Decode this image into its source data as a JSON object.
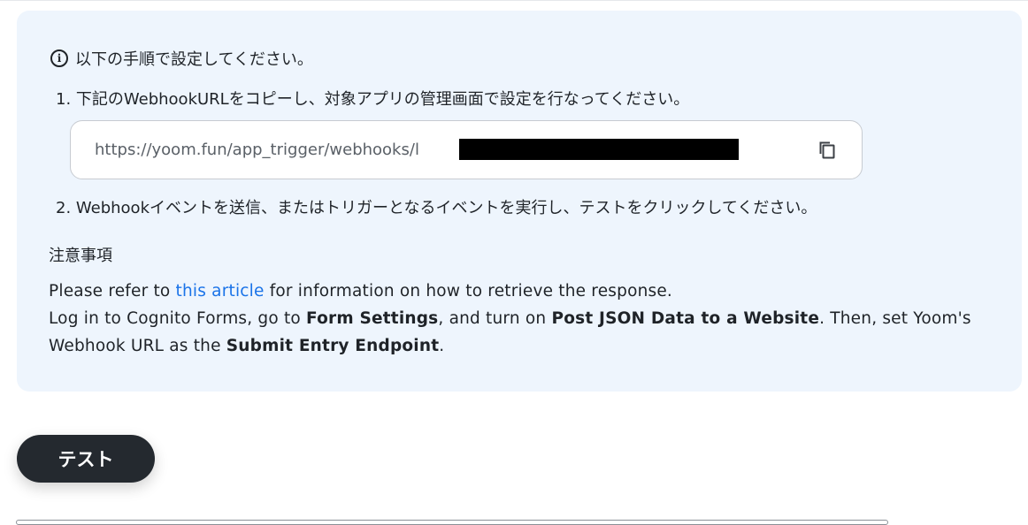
{
  "info": {
    "icon": "info-icon",
    "glyph": "i",
    "text": "以下の手順で設定してください。"
  },
  "steps": [
    {
      "text": "1. 下記のWebhookURLをコピーし、対象アプリの管理画面で設定を行なってください。"
    },
    {
      "text": "2. Webhookイベントを送信、またはトリガーとなるイベントを実行し、テストをクリックしてください。"
    }
  ],
  "webhook": {
    "url_visible": "https://yoom.fun/app_trigger/webhooks/",
    "url_partial_char": "l",
    "copy_icon": "copy-icon"
  },
  "notes": {
    "title": "注意事項",
    "line1_pre": "Please refer to ",
    "line1_link": "this article",
    "line1_post": " for information on how to retrieve the response.",
    "line2_a": "Log in to Cognito Forms, go to ",
    "line2_b": "Form Settings",
    "line2_c": ", and turn on ",
    "line2_d": "Post JSON Data to a Website",
    "line2_e": ". Then, set Yoom's Webhook URL as the ",
    "line2_f": "Submit Entry Endpoint",
    "line2_g": "."
  },
  "buttons": {
    "test_label": "テスト"
  },
  "colors": {
    "panel_bg": "#eef5fd",
    "link": "#1a73e8",
    "button_bg": "#24292f"
  }
}
